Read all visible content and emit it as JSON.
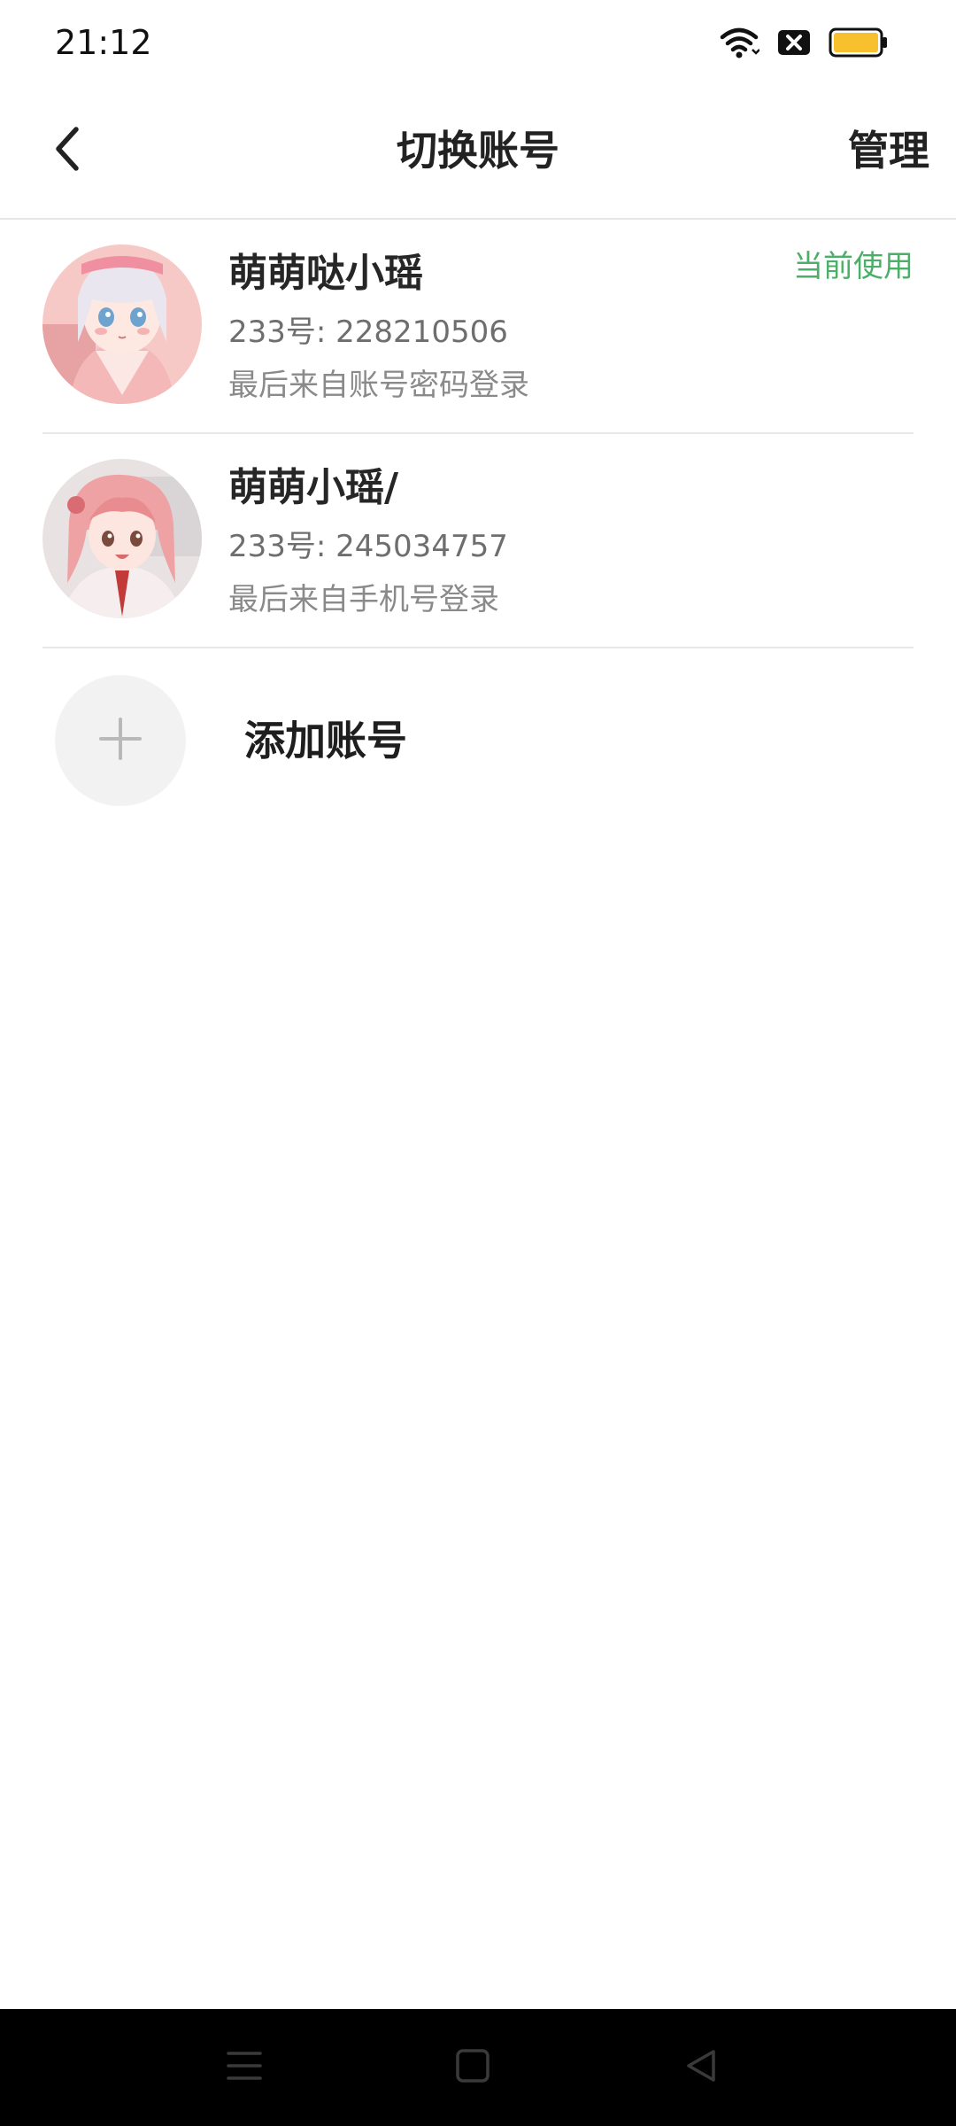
{
  "status_bar": {
    "time": "21:12",
    "icons": [
      "wifi-icon",
      "sim-blocked-icon",
      "battery-icon"
    ],
    "battery_color": "#f7c02c"
  },
  "header": {
    "back_icon": "chevron-left-icon",
    "title": "切换账号",
    "manage_label": "管理"
  },
  "accounts": [
    {
      "name": "萌萌哒小瑶",
      "id_text": "233号: 228210506",
      "login_text": "最后来自账号密码登录",
      "badge": "当前使用",
      "avatar_icon": "avatar-anime-girl-white-hair"
    },
    {
      "name": "萌萌小瑶/",
      "id_text": "233号: 245034757",
      "login_text": "最后来自手机号登录",
      "avatar_icon": "avatar-anime-girl-pink-hair"
    }
  ],
  "add_account": {
    "label": "添加账号",
    "icon": "plus-icon"
  },
  "nav_bar": {
    "items": [
      "menu-icon",
      "home-icon",
      "back-triangle-icon"
    ]
  },
  "colors": {
    "accent_green": "#4caf67",
    "divider": "#e8e8e8",
    "nav_background": "#000000"
  }
}
